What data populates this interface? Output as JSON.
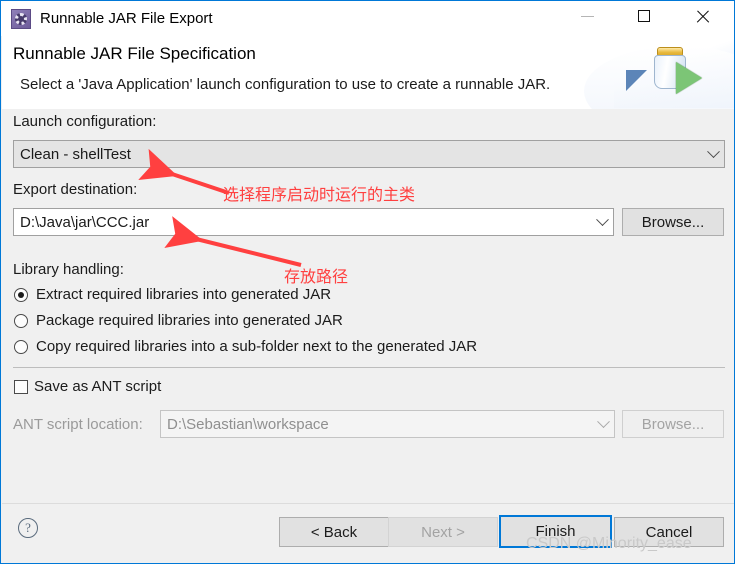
{
  "window": {
    "title": "Runnable JAR File Export",
    "icon": "jar-export-icon",
    "controls": {
      "minimize": "—",
      "maximize": "□",
      "close": "✕"
    }
  },
  "header": {
    "title": "Runnable JAR File Specification",
    "description": "Select a 'Java Application' launch configuration to use to create a runnable JAR.",
    "art_icon": "jar-with-green-arrow-icon"
  },
  "form": {
    "launch_configuration": {
      "label": "Launch configuration:",
      "value": "Clean - shellTest",
      "arrow_icon": "chevron-down-icon"
    },
    "export_destination": {
      "label": "Export destination:",
      "value": "D:\\Java\\jar\\CCC.jar",
      "arrow_icon": "chevron-down-icon",
      "browse_label": "Browse..."
    },
    "library_handling": {
      "label": "Library handling:",
      "options": [
        {
          "label": "Extract required libraries into generated JAR",
          "selected": true
        },
        {
          "label": "Package required libraries into generated JAR",
          "selected": false
        },
        {
          "label": "Copy required libraries into a sub-folder next to the generated JAR",
          "selected": false
        }
      ]
    },
    "ant_script": {
      "checkbox_label": "Save as ANT script",
      "checked": false,
      "location_label": "ANT script location:",
      "location_value": "D:\\Sebastian\\workspace",
      "arrow_icon": "chevron-down-icon",
      "browse_label": "Browse...",
      "enabled": false
    }
  },
  "footer": {
    "help_icon": "question-mark-icon",
    "buttons": {
      "back": "< Back",
      "next": "Next >",
      "finish": "Finish",
      "cancel": "Cancel"
    }
  },
  "annotations": [
    {
      "text": "选择程序启动时运行的主类",
      "color": "#ff4040"
    },
    {
      "text": "存放路径",
      "color": "#ff4040"
    }
  ],
  "watermark": "CSDN @Minority_ease",
  "colors": {
    "accent": "#0078d7",
    "dialog_bg": "#f0f0f0",
    "annotation_red": "#ff4040"
  }
}
